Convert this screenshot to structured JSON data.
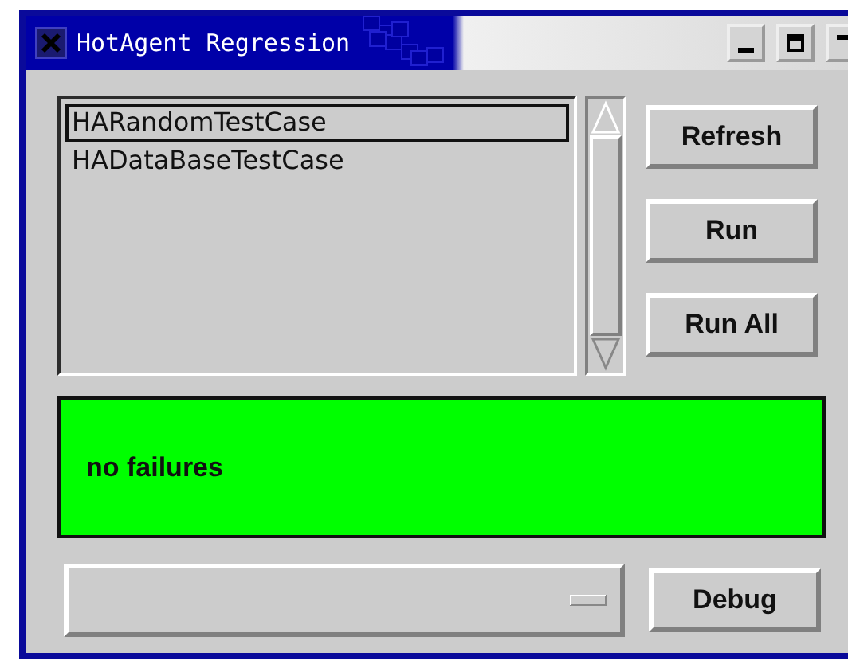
{
  "window": {
    "title": "HotAgent Regression"
  },
  "test_list": {
    "items": [
      {
        "label": "HARandomTestCase",
        "selected": true
      },
      {
        "label": "HADataBaseTestCase",
        "selected": false
      }
    ]
  },
  "side_buttons": [
    "Refresh",
    "Run",
    "Run All"
  ],
  "status": {
    "message": "no failures",
    "color": "#00ff00"
  },
  "bottom_button": "Debug"
}
